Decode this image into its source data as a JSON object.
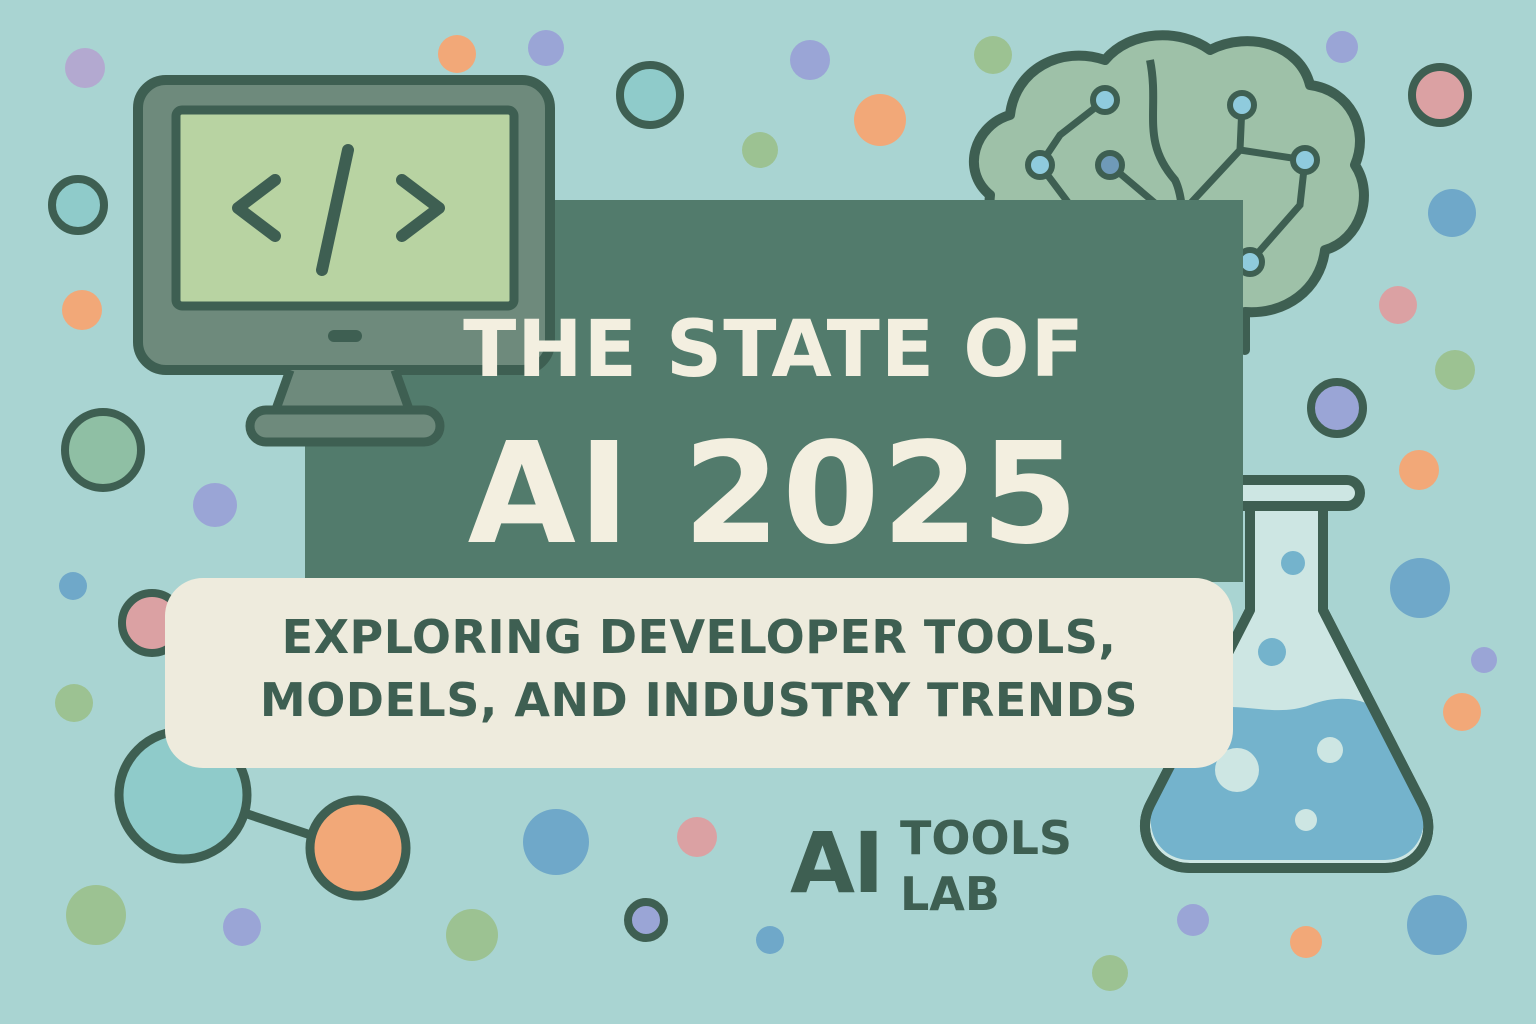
{
  "title": {
    "line1": "THE STATE OF",
    "line2": "AI 2025"
  },
  "subtitle": {
    "line1": "EXPLORING DEVELOPER TOOLS,",
    "line2": "MODELS, AND INDUSTRY TRENDS"
  },
  "logo": {
    "ai": "AI",
    "tools": "TOOLS",
    "lab": "LAB"
  },
  "monitor_code_glyph": "</>",
  "colors": {
    "background": "#a9d4d2",
    "panel": "#527b6c",
    "cream": "#eeebdd",
    "outline": "#3e5f52",
    "accent_orange": "#f2a878",
    "accent_purple": "#9aa5d6",
    "accent_green": "#9cc292",
    "accent_blue": "#6fa8c9",
    "accent_pink": "#dba1a3",
    "accent_teal": "#8fcbca"
  },
  "icons": [
    "code-monitor-icon",
    "brain-network-icon",
    "flask-icon",
    "molecule-icon"
  ]
}
